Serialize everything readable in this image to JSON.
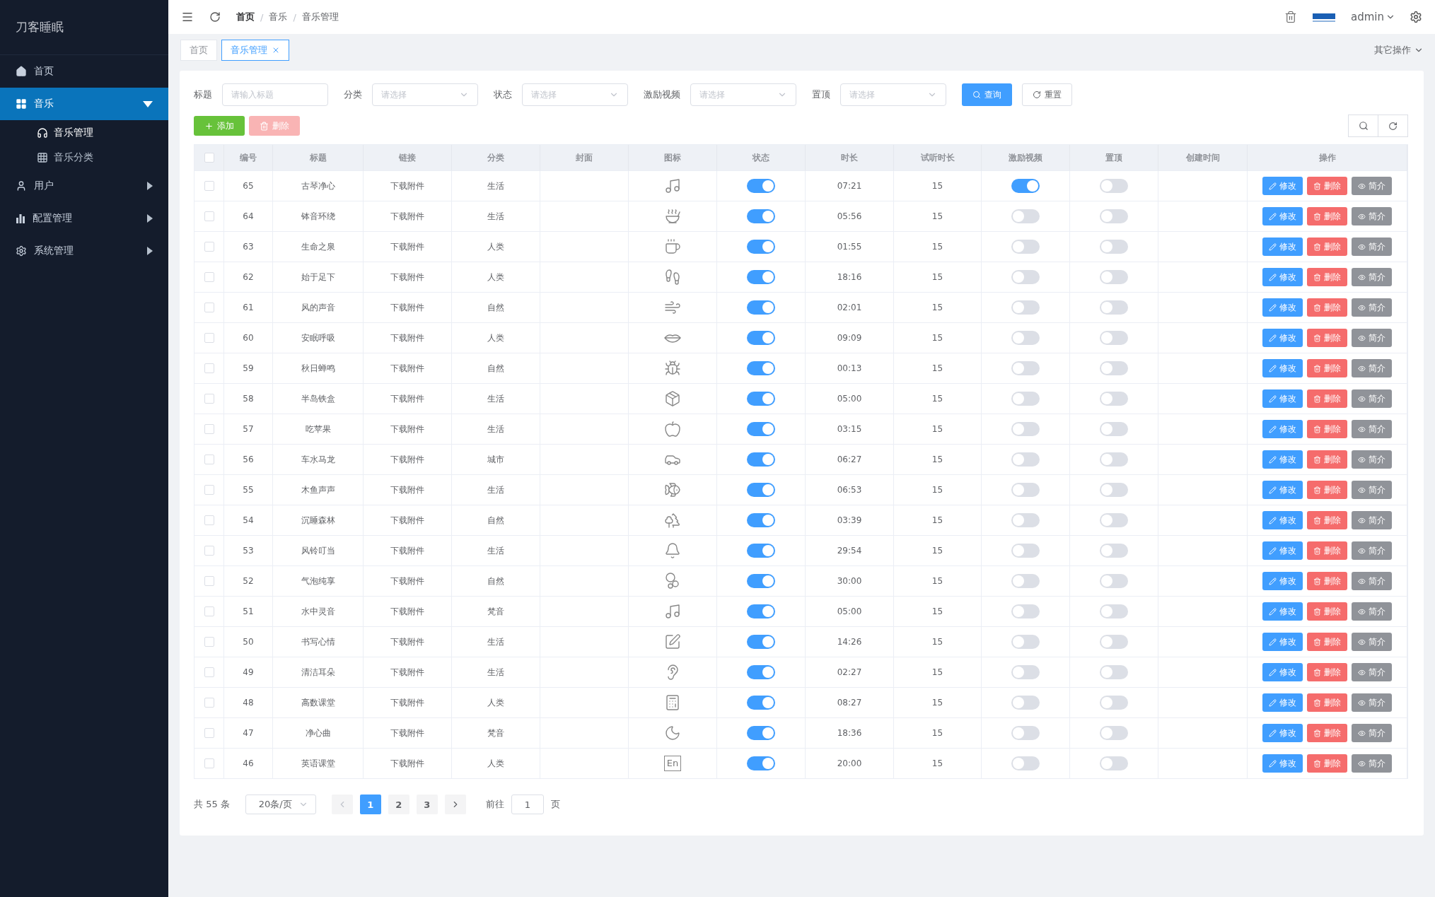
{
  "sidebar": {
    "title": "刀客睡眠",
    "items": [
      {
        "kind": "home",
        "label": "首页",
        "selected": false
      },
      {
        "kind": "grid",
        "label": "音乐",
        "selected": true,
        "expanded": true,
        "children": [
          {
            "kind": "headphones",
            "label": "音乐管理",
            "selected": true
          },
          {
            "kind": "apps",
            "label": "音乐分类",
            "selected": false
          }
        ]
      },
      {
        "kind": "user",
        "label": "用户",
        "selected": false,
        "expanded": false
      },
      {
        "kind": "chart",
        "label": "配置管理",
        "selected": false,
        "expanded": false
      },
      {
        "kind": "gear",
        "label": "系统管理",
        "selected": false,
        "expanded": false
      }
    ]
  },
  "header": {
    "breadcrumb": [
      {
        "label": "首页"
      },
      {
        "separator": "/",
        "label": "音乐"
      },
      {
        "separator": "/",
        "label": "音乐管理"
      }
    ],
    "user": "admin"
  },
  "tabs": [
    {
      "label": "首页",
      "selected": false,
      "closable": false
    },
    {
      "label": "音乐管理",
      "selected": true,
      "closable": true
    }
  ],
  "other_actions": "其它操作",
  "filters": [
    {
      "kind": "input",
      "label": "标题",
      "placeholder": "请输入标题"
    },
    {
      "kind": "select",
      "label": "分类",
      "placeholder": "请选择"
    },
    {
      "kind": "select",
      "label": "状态",
      "placeholder": "请选择"
    },
    {
      "kind": "select",
      "label": "激励视频",
      "placeholder": "请选择"
    },
    {
      "kind": "select",
      "label": "置顶",
      "placeholder": "请选择"
    }
  ],
  "filter_buttons": [
    {
      "kind": "search",
      "label": "查询"
    },
    {
      "kind": "reset",
      "label": "重置"
    }
  ],
  "toolbar": [
    {
      "kind": "add",
      "label": "添加",
      "disabled": false
    },
    {
      "kind": "delete",
      "label": "删除",
      "disabled": true
    }
  ],
  "table": {
    "header_checked": false,
    "columns": [
      "编号",
      "标题",
      "链接",
      "分类",
      "封面",
      "图标",
      "状态",
      "时长",
      "试听时长",
      "激励视频",
      "置顶",
      "创建时间",
      "操作"
    ],
    "rows": [
      {
        "checked": false,
        "id": "65",
        "title": "古琴净心",
        "link": "下载附件",
        "category": "生活",
        "status": true,
        "duration": "07:21",
        "trial": "15",
        "reward": true,
        "top": false,
        "actions": [
          "修改",
          "删除",
          "简介"
        ]
      },
      {
        "checked": false,
        "id": "64",
        "title": "钵音环绕",
        "link": "下载附件",
        "category": "生活",
        "status": true,
        "duration": "05:56",
        "trial": "15",
        "reward": false,
        "top": false,
        "actions": [
          "修改",
          "删除",
          "简介"
        ]
      },
      {
        "checked": false,
        "id": "63",
        "title": "生命之泉",
        "link": "下载附件",
        "category": "人类",
        "status": true,
        "duration": "01:55",
        "trial": "15",
        "reward": false,
        "top": false,
        "actions": [
          "修改",
          "删除",
          "简介"
        ]
      },
      {
        "checked": false,
        "id": "62",
        "title": "始于足下",
        "link": "下载附件",
        "category": "人类",
        "status": true,
        "duration": "18:16",
        "trial": "15",
        "reward": false,
        "top": false,
        "actions": [
          "修改",
          "删除",
          "简介"
        ]
      },
      {
        "checked": false,
        "id": "61",
        "title": "风的声音",
        "link": "下载附件",
        "category": "自然",
        "status": true,
        "duration": "02:01",
        "trial": "15",
        "reward": false,
        "top": false,
        "actions": [
          "修改",
          "删除",
          "简介"
        ]
      },
      {
        "checked": false,
        "id": "60",
        "title": "安眠呼吸",
        "link": "下载附件",
        "category": "人类",
        "status": true,
        "duration": "09:09",
        "trial": "15",
        "reward": false,
        "top": false,
        "actions": [
          "修改",
          "删除",
          "简介"
        ]
      },
      {
        "checked": false,
        "id": "59",
        "title": "秋日蝉鸣",
        "link": "下载附件",
        "category": "自然",
        "status": true,
        "duration": "00:13",
        "trial": "15",
        "reward": false,
        "top": false,
        "actions": [
          "修改",
          "删除",
          "简介"
        ]
      },
      {
        "checked": false,
        "id": "58",
        "title": "半岛铁盒",
        "link": "下载附件",
        "category": "生活",
        "status": true,
        "duration": "05:00",
        "trial": "15",
        "reward": false,
        "top": false,
        "actions": [
          "修改",
          "删除",
          "简介"
        ]
      },
      {
        "checked": false,
        "id": "57",
        "title": "吃苹果",
        "link": "下载附件",
        "category": "生活",
        "status": true,
        "duration": "03:15",
        "trial": "15",
        "reward": false,
        "top": false,
        "actions": [
          "修改",
          "删除",
          "简介"
        ]
      },
      {
        "checked": false,
        "id": "56",
        "title": "车水马龙",
        "link": "下载附件",
        "category": "城市",
        "status": true,
        "duration": "06:27",
        "trial": "15",
        "reward": false,
        "top": false,
        "actions": [
          "修改",
          "删除",
          "简介"
        ]
      },
      {
        "checked": false,
        "id": "55",
        "title": "木鱼声声",
        "link": "下载附件",
        "category": "生活",
        "status": true,
        "duration": "06:53",
        "trial": "15",
        "reward": false,
        "top": false,
        "actions": [
          "修改",
          "删除",
          "简介"
        ]
      },
      {
        "checked": false,
        "id": "54",
        "title": "沉睡森林",
        "link": "下载附件",
        "category": "自然",
        "status": true,
        "duration": "03:39",
        "trial": "15",
        "reward": false,
        "top": false,
        "actions": [
          "修改",
          "删除",
          "简介"
        ]
      },
      {
        "checked": false,
        "id": "53",
        "title": "风铃叮当",
        "link": "下载附件",
        "category": "生活",
        "status": true,
        "duration": "29:54",
        "trial": "15",
        "reward": false,
        "top": false,
        "actions": [
          "修改",
          "删除",
          "简介"
        ]
      },
      {
        "checked": false,
        "id": "52",
        "title": "气泡纯享",
        "link": "下载附件",
        "category": "自然",
        "status": true,
        "duration": "30:00",
        "trial": "15",
        "reward": false,
        "top": false,
        "actions": [
          "修改",
          "删除",
          "简介"
        ]
      },
      {
        "checked": false,
        "id": "51",
        "title": "水中灵音",
        "link": "下载附件",
        "category": "梵音",
        "status": true,
        "duration": "05:00",
        "trial": "15",
        "reward": false,
        "top": false,
        "actions": [
          "修改",
          "删除",
          "简介"
        ]
      },
      {
        "checked": false,
        "id": "50",
        "title": "书写心情",
        "link": "下载附件",
        "category": "生活",
        "status": true,
        "duration": "14:26",
        "trial": "15",
        "reward": false,
        "top": false,
        "actions": [
          "修改",
          "删除",
          "简介"
        ]
      },
      {
        "checked": false,
        "id": "49",
        "title": "清洁耳朵",
        "link": "下载附件",
        "category": "生活",
        "status": true,
        "duration": "02:27",
        "trial": "15",
        "reward": false,
        "top": false,
        "actions": [
          "修改",
          "删除",
          "简介"
        ]
      },
      {
        "checked": false,
        "id": "48",
        "title": "高数课堂",
        "link": "下载附件",
        "category": "人类",
        "status": true,
        "duration": "08:27",
        "trial": "15",
        "reward": false,
        "top": false,
        "actions": [
          "修改",
          "删除",
          "简介"
        ]
      },
      {
        "checked": false,
        "id": "47",
        "title": "净心曲",
        "link": "下载附件",
        "category": "梵音",
        "status": true,
        "duration": "18:36",
        "trial": "15",
        "reward": false,
        "top": false,
        "actions": [
          "修改",
          "删除",
          "简介"
        ]
      },
      {
        "checked": false,
        "id": "46",
        "title": "英语课堂",
        "link": "下载附件",
        "category": "人类",
        "icon_text": "En",
        "status": true,
        "duration": "20:00",
        "trial": "15",
        "reward": false,
        "top": false,
        "actions": [
          "修改",
          "删除",
          "简介"
        ]
      }
    ]
  },
  "pagination": {
    "total": "共 55 条",
    "page_size": "20条/页",
    "pages": [
      {
        "label": "1",
        "selected": true
      },
      {
        "label": "2",
        "selected": false
      },
      {
        "label": "3",
        "selected": false
      }
    ],
    "goto_label": "前往",
    "goto_value": "1",
    "goto_suffix": "页"
  }
}
